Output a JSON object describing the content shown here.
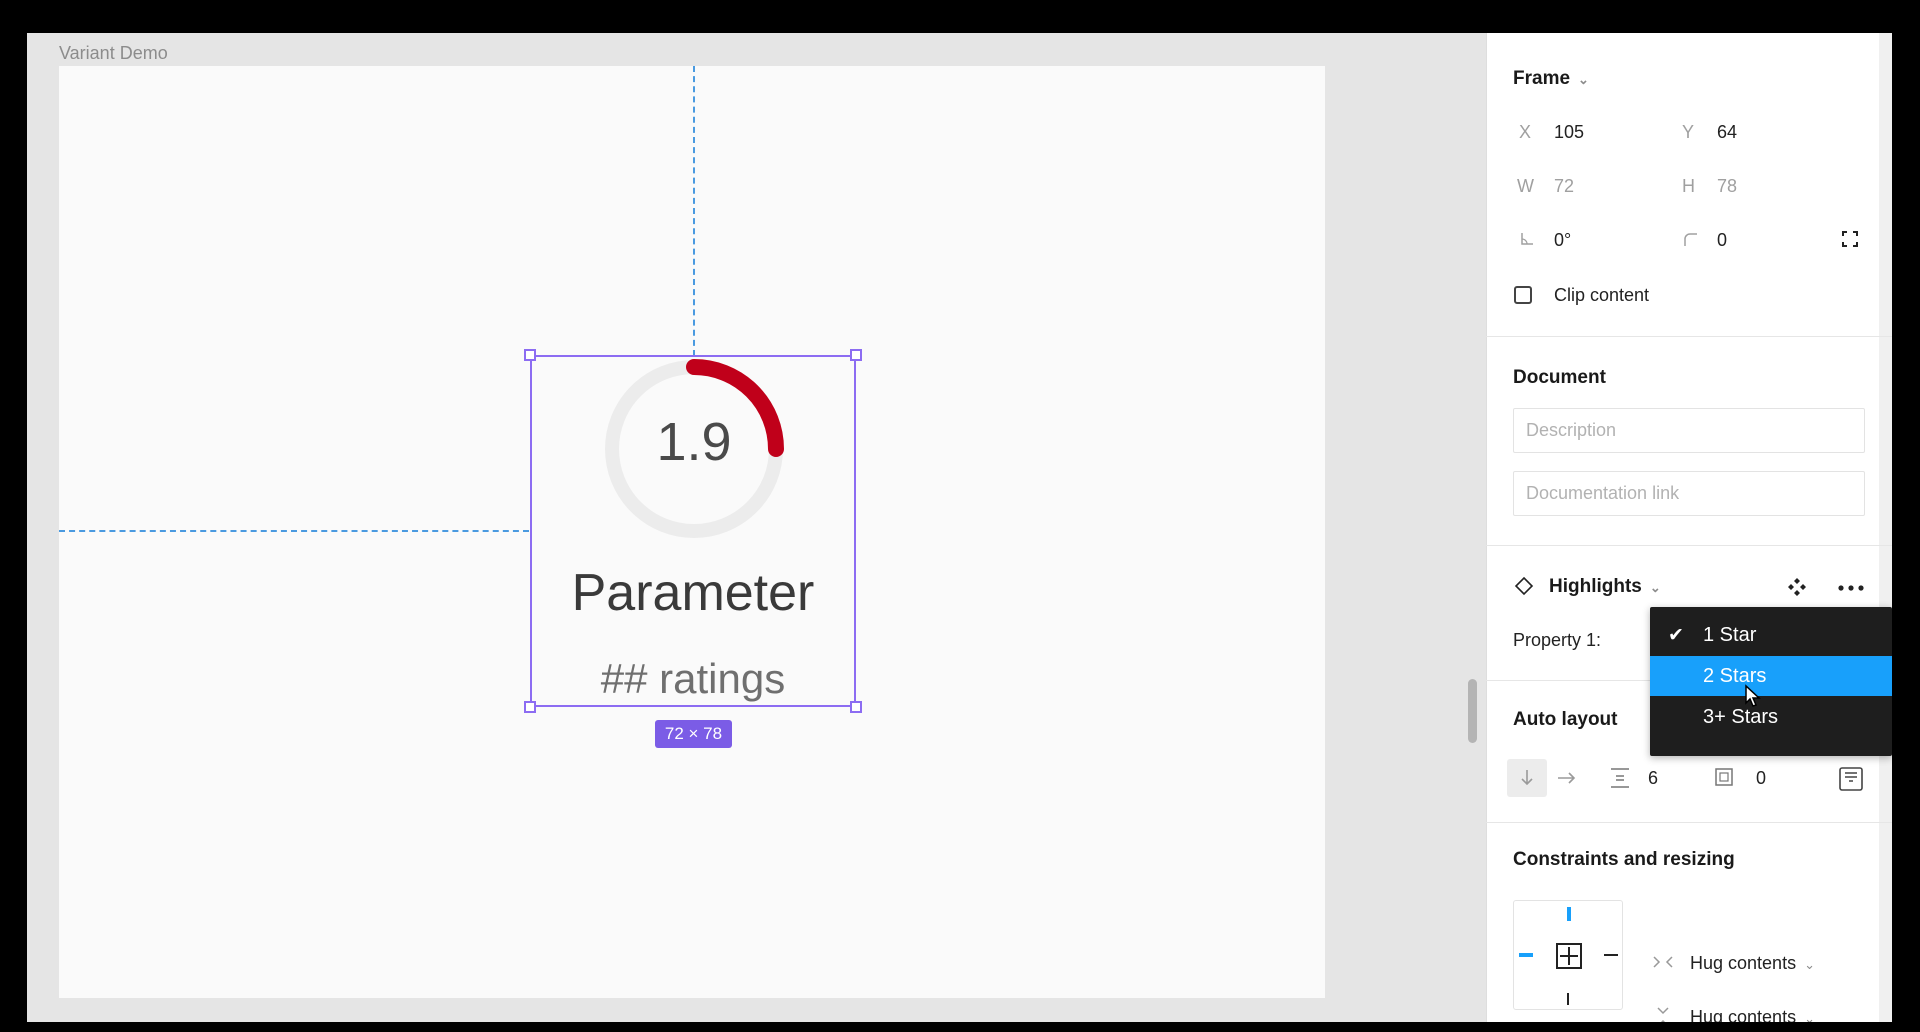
{
  "canvas": {
    "frame_label": "Variant Demo",
    "component": {
      "gauge_value": "1.9",
      "gauge_fraction": 0.25,
      "gauge_color": "#c0001a",
      "title": "Parameter",
      "subtitle": "## ratings"
    },
    "size_badge": "72 × 78"
  },
  "panel": {
    "frame": {
      "title": "Frame",
      "x_label": "X",
      "x_value": "105",
      "y_label": "Y",
      "y_value": "64",
      "w_label": "W",
      "w_value": "72",
      "h_label": "H",
      "h_value": "78",
      "rotation_value": "0°",
      "radius_value": "0",
      "clip_label": "Clip content"
    },
    "document": {
      "title": "Document",
      "description_placeholder": "Description",
      "doc_link_placeholder": "Documentation link"
    },
    "component": {
      "name": "Highlights",
      "property_label": "Property 1:"
    },
    "dropdown": {
      "options": [
        "1 Star",
        "2 Stars",
        "3+ Stars"
      ],
      "selected": "1 Star",
      "hovered": "2 Stars"
    },
    "auto_layout": {
      "title": "Auto layout",
      "spacing": "6",
      "padding": "0"
    },
    "constraints": {
      "title": "Constraints and resizing",
      "horizontal": "Hug contents",
      "vertical": "Hug contents"
    }
  },
  "colors": {
    "selection": "#8c6cf2",
    "accent": "#18a0fb",
    "guide": "#4a9ae0"
  }
}
